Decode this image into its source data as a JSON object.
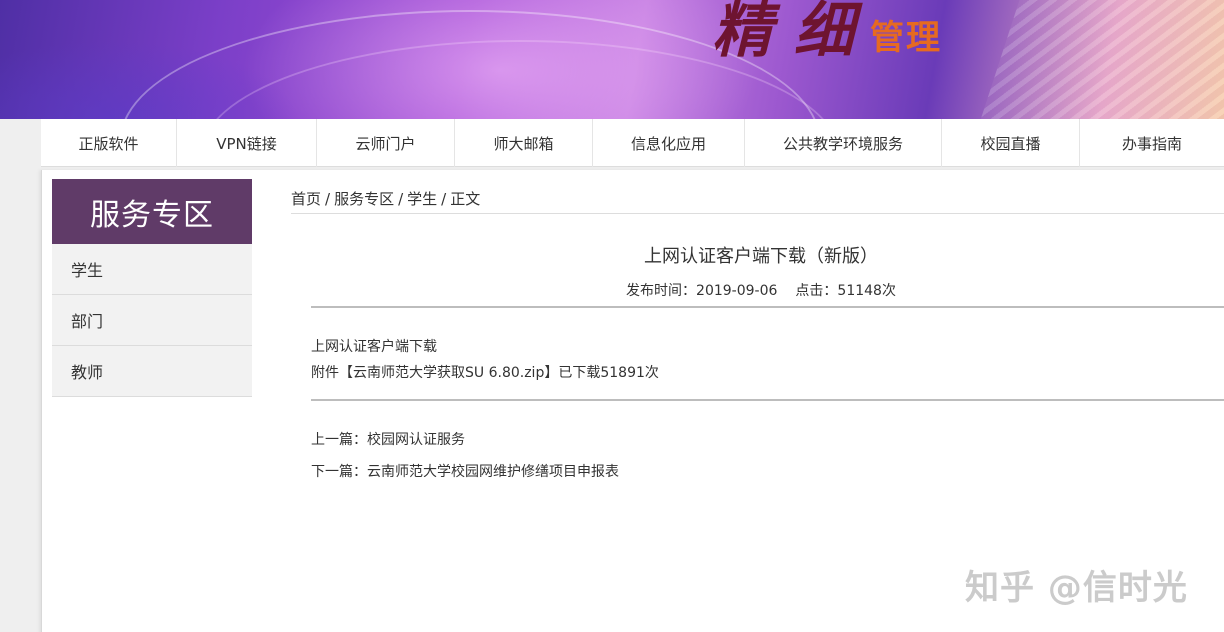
{
  "banner": {
    "big_text": "精细",
    "sub_text": "管理"
  },
  "nav": {
    "items": [
      "正版软件",
      "VPN链接",
      "云师门户",
      "师大邮箱",
      "信息化应用",
      "公共教学环境服务",
      "校园直播",
      "办事指南"
    ]
  },
  "sidebar": {
    "title": "服务专区",
    "items": [
      "学生",
      "部门",
      "教师"
    ]
  },
  "breadcrumb": {
    "items": [
      "首页",
      "服务专区",
      "学生",
      "正文"
    ],
    "separator": "/"
  },
  "article": {
    "title": "上网认证客户端下载（新版）",
    "publish_label": "发布时间：",
    "publish_date": "2019-09-06",
    "clicks_label": "点击：",
    "clicks_value": "51148次",
    "body_line1": "上网认证客户端下载",
    "attachment_prefix": "附件【",
    "attachment_name": "云南师范大学获取SU 6.80.zip",
    "attachment_suffix": "】已下载51891次"
  },
  "pager": {
    "prev_label": "上一篇：",
    "prev_title": "校园网认证服务",
    "next_label": "下一篇：",
    "next_title": "云南师范大学校园网维护修缮项目申报表"
  },
  "watermark": "知乎 @信时光",
  "colors": {
    "sidebar_title_bg": "#603b68",
    "banner_accent": "#e66a20"
  }
}
